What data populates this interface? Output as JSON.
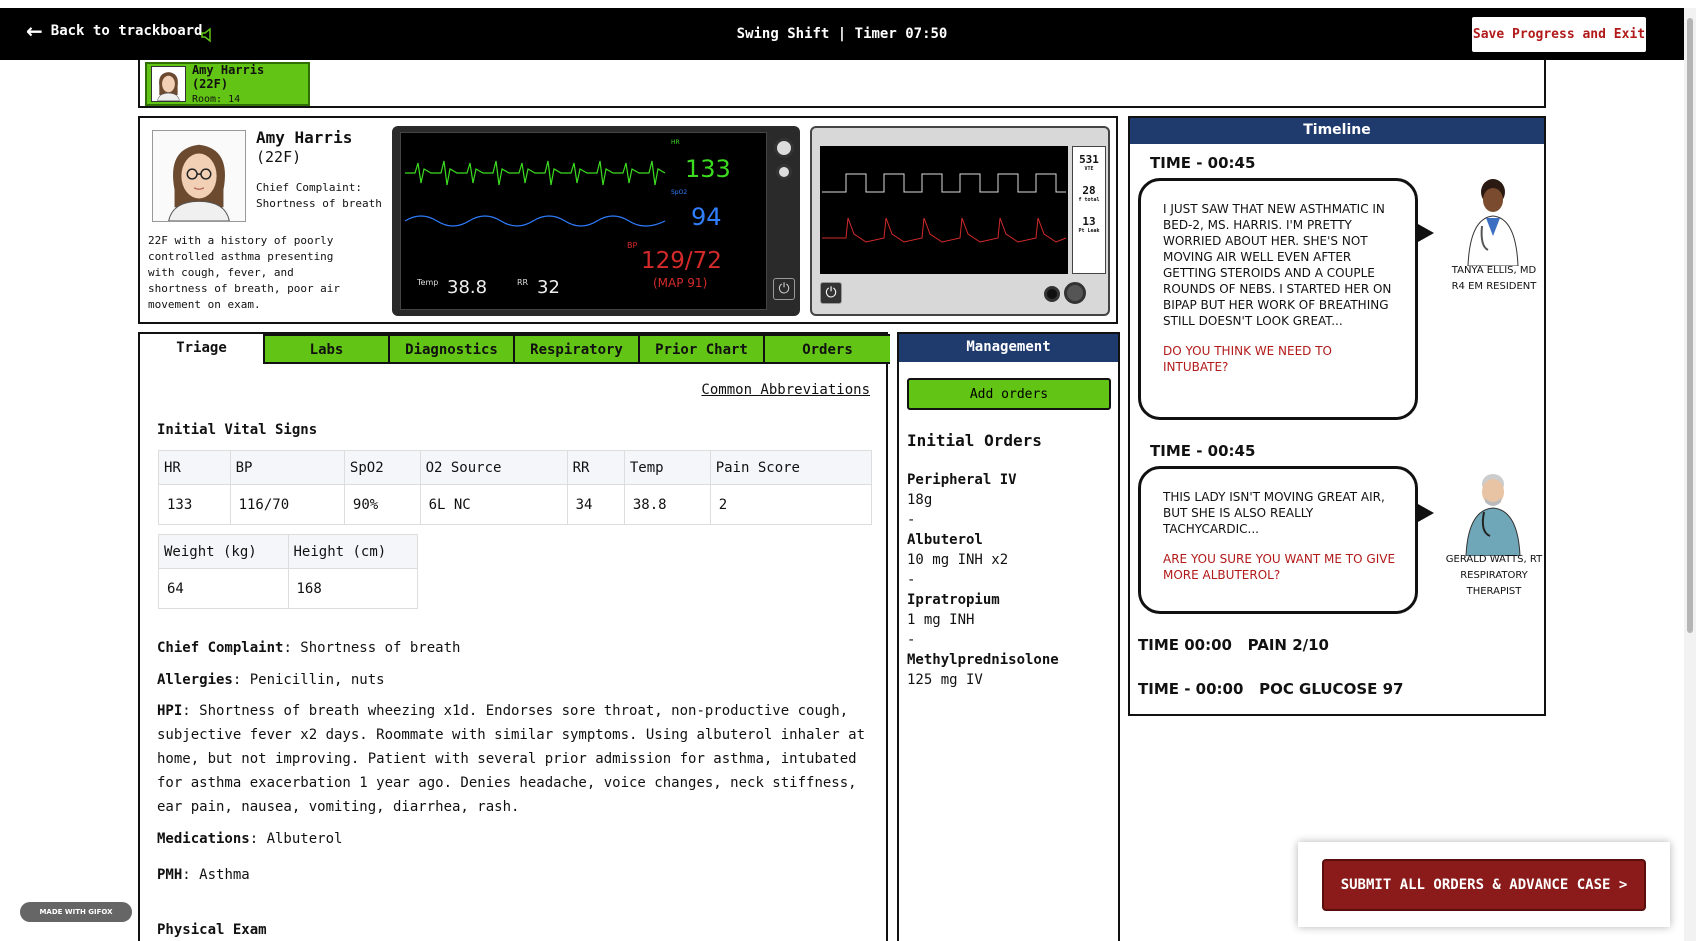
{
  "header": {
    "back_label": "Back to trackboard",
    "shift_timer": "Swing Shift | Timer 07:50",
    "save_label": "Save Progress and Exit"
  },
  "patient_tab": {
    "name": "Amy Harris (22F)",
    "room": "Room: 14"
  },
  "patient": {
    "name": "Amy Harris",
    "age": "(22F)",
    "cc_label": "Chief Complaint:",
    "cc_value": "Shortness of breath",
    "history": "22F with a history of poorly controlled asthma presenting with cough, fever, and shortness of breath, poor air movement on exam."
  },
  "monitor": {
    "hr_label": "HR",
    "hr": "133",
    "spo2_label": "SpO2",
    "spo2": "94",
    "bp_label": "BP",
    "bp": "129/72",
    "map": "(MAP  91)",
    "temp_label": "Temp",
    "temp": "38.8",
    "rr_label": "RR",
    "rr": "32"
  },
  "ventilator": {
    "vte": "531",
    "vte_label": "VTE",
    "rate": "28",
    "rate_label": "f total",
    "peep": "13",
    "peep_label": "Pt Leak"
  },
  "tabs": [
    "Triage",
    "Labs",
    "Diagnostics",
    "Respiratory",
    "Prior Chart",
    "Orders"
  ],
  "triage": {
    "abbreviations": "Common Abbreviations",
    "vitals_title": "Initial Vital Signs",
    "vitals_headers": [
      "HR",
      "BP",
      "SpO2",
      "O2 Source",
      "RR",
      "Temp",
      "Pain Score"
    ],
    "vitals_values": [
      "133",
      "116/70",
      "90%",
      "6L NC",
      "34",
      "38.8",
      "2"
    ],
    "body_headers": [
      "Weight (kg)",
      "Height (cm)"
    ],
    "body_values": [
      "64",
      "168"
    ],
    "cc_label": "Chief Complaint",
    "cc_value": ": Shortness of breath",
    "allergies_label": "Allergies",
    "allergies_value": ": Penicillin, nuts",
    "hpi_label": "HPI",
    "hpi_value": ": Shortness of breath wheezing x1d. Endorses sore throat, non-productive cough, subjective fever x2 days. Roommate with similar symptoms. Using albuterol inhaler at home, but not improving. Patient with several prior admission for asthma, intubated for asthma exacerbation 1 year ago. Denies headache, voice changes, neck stiffness, ear pain, nausea, vomiting, diarrhea, rash.",
    "meds_label": "Medications",
    "meds_value": ": Albuterol",
    "pmh_label": "PMH",
    "pmh_value": ": Asthma",
    "exam_title": "Physical Exam"
  },
  "management": {
    "title": "Management",
    "add_label": "Add orders",
    "orders_title": "Initial Orders",
    "orders": [
      {
        "name": "Peripheral IV",
        "detail": "18g"
      },
      {
        "name": "Albuterol",
        "detail": "10 mg INH x2"
      },
      {
        "name": "Ipratropium",
        "detail": "1 mg INH"
      },
      {
        "name": "Methylprednisolone",
        "detail": "125 mg IV"
      }
    ],
    "separator": "-"
  },
  "timeline": {
    "title": "Timeline",
    "events": [
      {
        "time": "TIME - 00:45",
        "text": "I just saw that new asthmatic in bed-2, Ms. Harris. I'm pretty worried about her. She's not moving air well even after getting steroids and a couple rounds of nebs. I started her on BiPAP but her work of breathing still doesn't look great...",
        "question": "Do you think we need to intubate?",
        "who": "Tanya Ellis, MD\nR4 EM Resident"
      },
      {
        "time": "TIME - 00:45",
        "text": "This lady isn't moving great air, but she is also really tachycardic...",
        "question": "Are you sure you want me to give more albuterol?",
        "who": "Gerald Watts, RT\nRespiratory Therapist"
      }
    ],
    "pain": "TIME 00:00   PAIN 2/10",
    "glucose": "TIME - 00:00   POC GLUCOSE 97"
  },
  "submit_label": "SUBMIT ALL ORDERS & ADVANCE CASE >",
  "watermark": "MADE WITH GIFOX",
  "colors": {
    "accent_green": "#62c414",
    "navy": "#1f3a6d",
    "danger_red": "#8b1a1a",
    "hr_green": "#3bdc1f",
    "spo2_blue": "#2f7fff",
    "bp_red": "#d42a2a"
  }
}
